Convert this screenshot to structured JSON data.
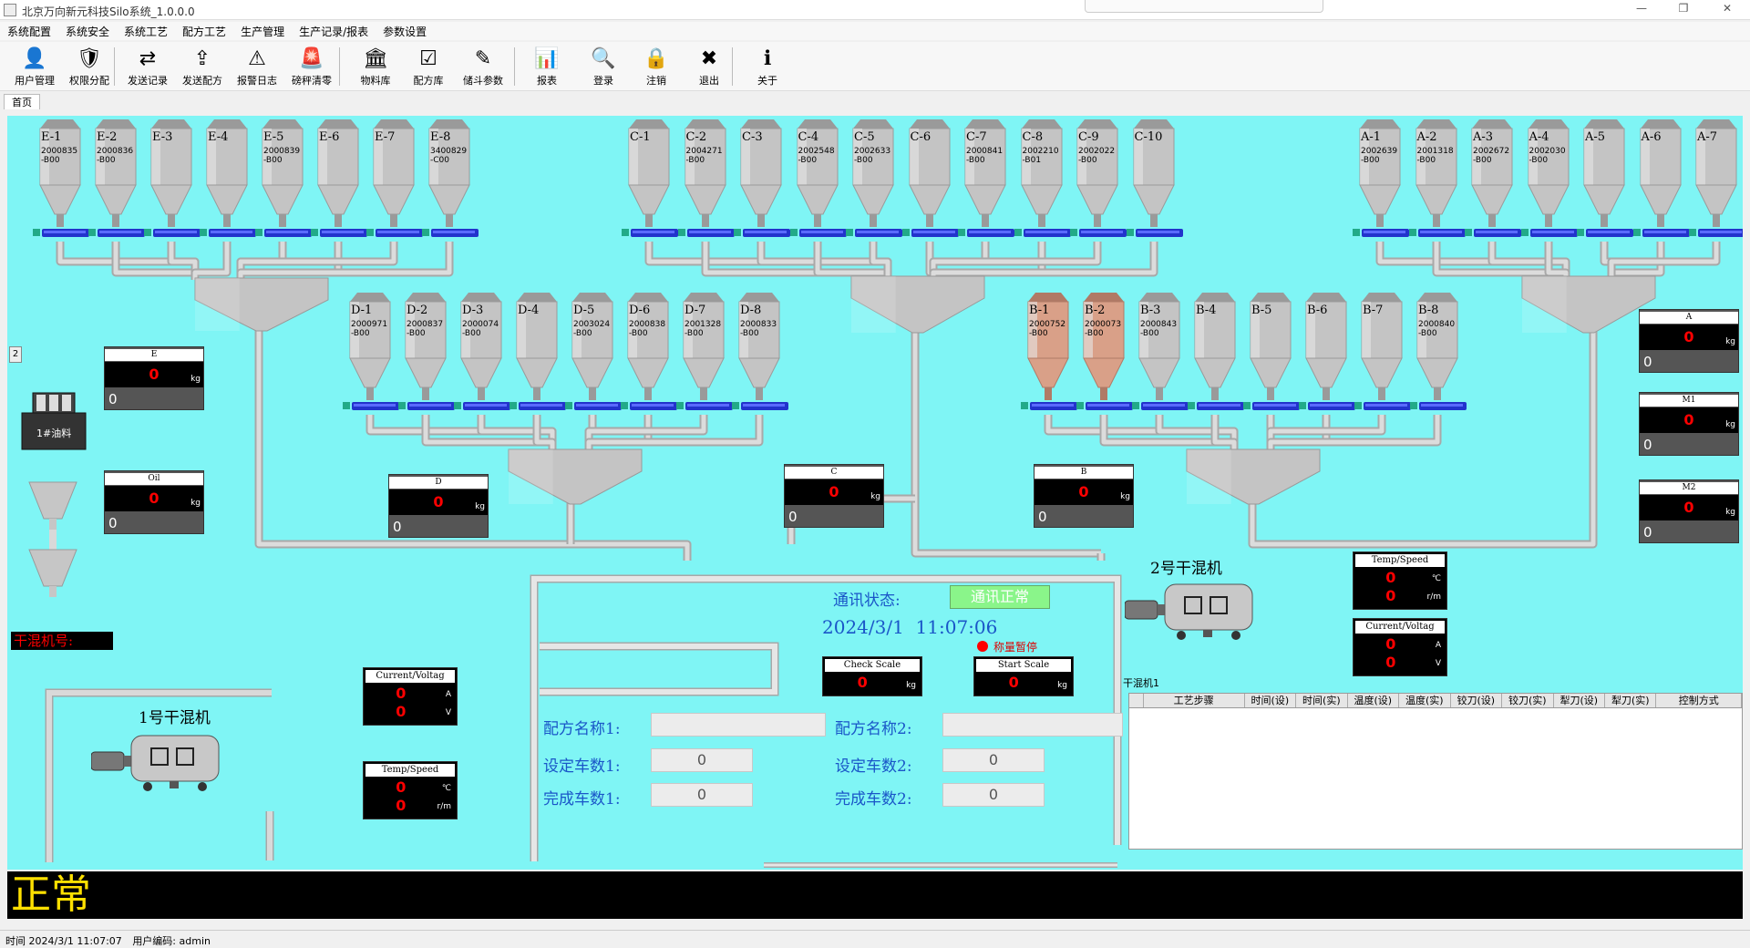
{
  "window": {
    "title": "北京万向新元科技Silo系统_1.0.0.0"
  },
  "menu": [
    "系统配置",
    "系统安全",
    "系统工艺",
    "配方工艺",
    "生产管理",
    "生产记录/报表",
    "参数设置"
  ],
  "toolbar": [
    {
      "label": "用户管理",
      "icon": "user-icon",
      "glyph": "👤"
    },
    {
      "label": "权限分配",
      "icon": "shield-icon",
      "glyph": "🛡"
    },
    {
      "label": "发送记录",
      "icon": "send-record-icon",
      "glyph": "⇄"
    },
    {
      "label": "发送配方",
      "icon": "send-recipe-icon",
      "glyph": "⇪"
    },
    {
      "label": "报警日志",
      "icon": "warning-icon",
      "glyph": "⚠"
    },
    {
      "label": "磅秤清零",
      "icon": "alarm-light-icon",
      "glyph": "🚨"
    },
    {
      "label": "物料库",
      "icon": "bank-icon",
      "glyph": "🏛"
    },
    {
      "label": "配方库",
      "icon": "checklist-icon",
      "glyph": "☑"
    },
    {
      "label": "储斗参数",
      "icon": "edit-icon",
      "glyph": "✎"
    },
    {
      "label": "报表",
      "icon": "report-icon",
      "glyph": "📊"
    },
    {
      "label": "登录",
      "icon": "login-icon",
      "glyph": "🔍"
    },
    {
      "label": "注销",
      "icon": "lock-icon",
      "glyph": "🔒"
    },
    {
      "label": "退出",
      "icon": "exit-icon",
      "glyph": "✖"
    },
    {
      "label": "关于",
      "icon": "info-icon",
      "glyph": "ℹ"
    }
  ],
  "tab": "首页",
  "silos_E": [
    {
      "name": "E-1",
      "code": "2000835\n-B00"
    },
    {
      "name": "E-2",
      "code": "2000836\n-B00"
    },
    {
      "name": "E-3",
      "code": ""
    },
    {
      "name": "E-4",
      "code": ""
    },
    {
      "name": "E-5",
      "code": "2000839\n-B00"
    },
    {
      "name": "E-6",
      "code": ""
    },
    {
      "name": "E-7",
      "code": ""
    },
    {
      "name": "E-8",
      "code": "3400829\n-C00"
    }
  ],
  "silos_C": [
    {
      "name": "C-1",
      "code": ""
    },
    {
      "name": "C-2",
      "code": "2004271\n-B00"
    },
    {
      "name": "C-3",
      "code": ""
    },
    {
      "name": "C-4",
      "code": "2002548\n-B00"
    },
    {
      "name": "C-5",
      "code": "2002633\n-B00"
    },
    {
      "name": "C-6",
      "code": ""
    },
    {
      "name": "C-7",
      "code": "2000841\n-B00"
    },
    {
      "name": "C-8",
      "code": "2002210\n-B01"
    },
    {
      "name": "C-9",
      "code": "2002022\n-B00"
    },
    {
      "name": "C-10",
      "code": ""
    }
  ],
  "silos_A": [
    {
      "name": "A-1",
      "code": "2002639\n-B00"
    },
    {
      "name": "A-2",
      "code": "2001318\n-B00"
    },
    {
      "name": "A-3",
      "code": "2002672\n-B00"
    },
    {
      "name": "A-4",
      "code": "2002030\n-B00"
    },
    {
      "name": "A-5",
      "code": ""
    },
    {
      "name": "A-6",
      "code": ""
    },
    {
      "name": "A-7",
      "code": ""
    }
  ],
  "silos_D": [
    {
      "name": "D-1",
      "code": "2000971\n-B00"
    },
    {
      "name": "D-2",
      "code": "2000837\n-B00"
    },
    {
      "name": "D-3",
      "code": "2000074\n-B00"
    },
    {
      "name": "D-4",
      "code": ""
    },
    {
      "name": "D-5",
      "code": "2003024\n-B00"
    },
    {
      "name": "D-6",
      "code": "2000838\n-B00"
    },
    {
      "name": "D-7",
      "code": "2001328\n-B00"
    },
    {
      "name": "D-8",
      "code": "2000833\n-B00"
    }
  ],
  "silos_B": [
    {
      "name": "B-1",
      "code": "2000752\n-B00",
      "active": true
    },
    {
      "name": "B-2",
      "code": "2000073\n-B00",
      "active": true
    },
    {
      "name": "B-3",
      "code": "2000843\n-B00"
    },
    {
      "name": "B-4",
      "code": ""
    },
    {
      "name": "B-5",
      "code": ""
    },
    {
      "name": "B-6",
      "code": ""
    },
    {
      "name": "B-7",
      "code": ""
    },
    {
      "name": "B-8",
      "code": "2000840\n-B00"
    }
  ],
  "scales": {
    "E": {
      "title": "E",
      "value": "0",
      "unit": "kg",
      "bottom": "0"
    },
    "Oil": {
      "title": "Oil",
      "value": "0",
      "unit": "kg",
      "bottom": "0"
    },
    "D": {
      "title": "D",
      "value": "0",
      "unit": "kg",
      "bottom": "0"
    },
    "C": {
      "title": "C",
      "value": "0",
      "unit": "kg",
      "bottom": "0"
    },
    "B": {
      "title": "B",
      "value": "0",
      "unit": "kg",
      "bottom": "0"
    },
    "A": {
      "title": "A",
      "value": "0",
      "unit": "kg",
      "bottom": "0"
    },
    "M1": {
      "title": "M1",
      "value": "0",
      "unit": "kg",
      "bottom": "0"
    },
    "M2": {
      "title": "M2",
      "value": "0",
      "unit": "kg",
      "bottom": "0"
    }
  },
  "page_badge": "2",
  "oil_tank": "1#油料",
  "mixer_no_label": "干混机号:",
  "mixer1": {
    "title": "1号干混机",
    "current": {
      "title": "Current/Voltag",
      "a": "0",
      "v": "0",
      "u1": "A",
      "u2": "V"
    },
    "temp": {
      "title": "Temp/Speed",
      "t": "0",
      "s": "0",
      "u1": "℃",
      "u2": "r/m"
    }
  },
  "mixer2": {
    "title": "2号干混机",
    "temp": {
      "title": "Temp/Speed",
      "t": "0",
      "s": "0",
      "u1": "℃",
      "u2": "r/m"
    },
    "current": {
      "title": "Current/Voltag",
      "a": "0",
      "v": "0",
      "u1": "A",
      "u2": "V"
    }
  },
  "comm": {
    "label": "通讯状态:",
    "status": "通讯正常",
    "datetime": "2024/3/1  11:07:06",
    "pause": "称量暂停"
  },
  "check_scale": {
    "title": "Check Scale",
    "value": "0",
    "unit": "kg"
  },
  "start_scale": {
    "title": "Start Scale",
    "value": "0",
    "unit": "kg"
  },
  "recipe": {
    "name1_label": "配方名称1:",
    "name1": "",
    "name2_label": "配方名称2:",
    "name2": "",
    "set1_label": "设定车数1:",
    "set1": "0",
    "set2_label": "设定车数2:",
    "set2": "0",
    "done1_label": "完成车数1:",
    "done1": "0",
    "done2_label": "完成车数2:",
    "done2": "0"
  },
  "table": {
    "caption": "干混机1",
    "columns": [
      "工艺步骤",
      "时间(设)",
      "时间(实)",
      "温度(设)",
      "温度(实)",
      "铰刀(设)",
      "铰刀(实)",
      "犁刀(设)",
      "犁刀(实)",
      "控制方式"
    ]
  },
  "banner": "正常",
  "statusbar": {
    "time": "时间 2024/3/1 11:07:07",
    "user": "用户编码: admin"
  },
  "colors": {
    "canvas": "#7ff5f5",
    "label_blue": "#1a56c8",
    "feeder_blue": "#2233cc"
  }
}
